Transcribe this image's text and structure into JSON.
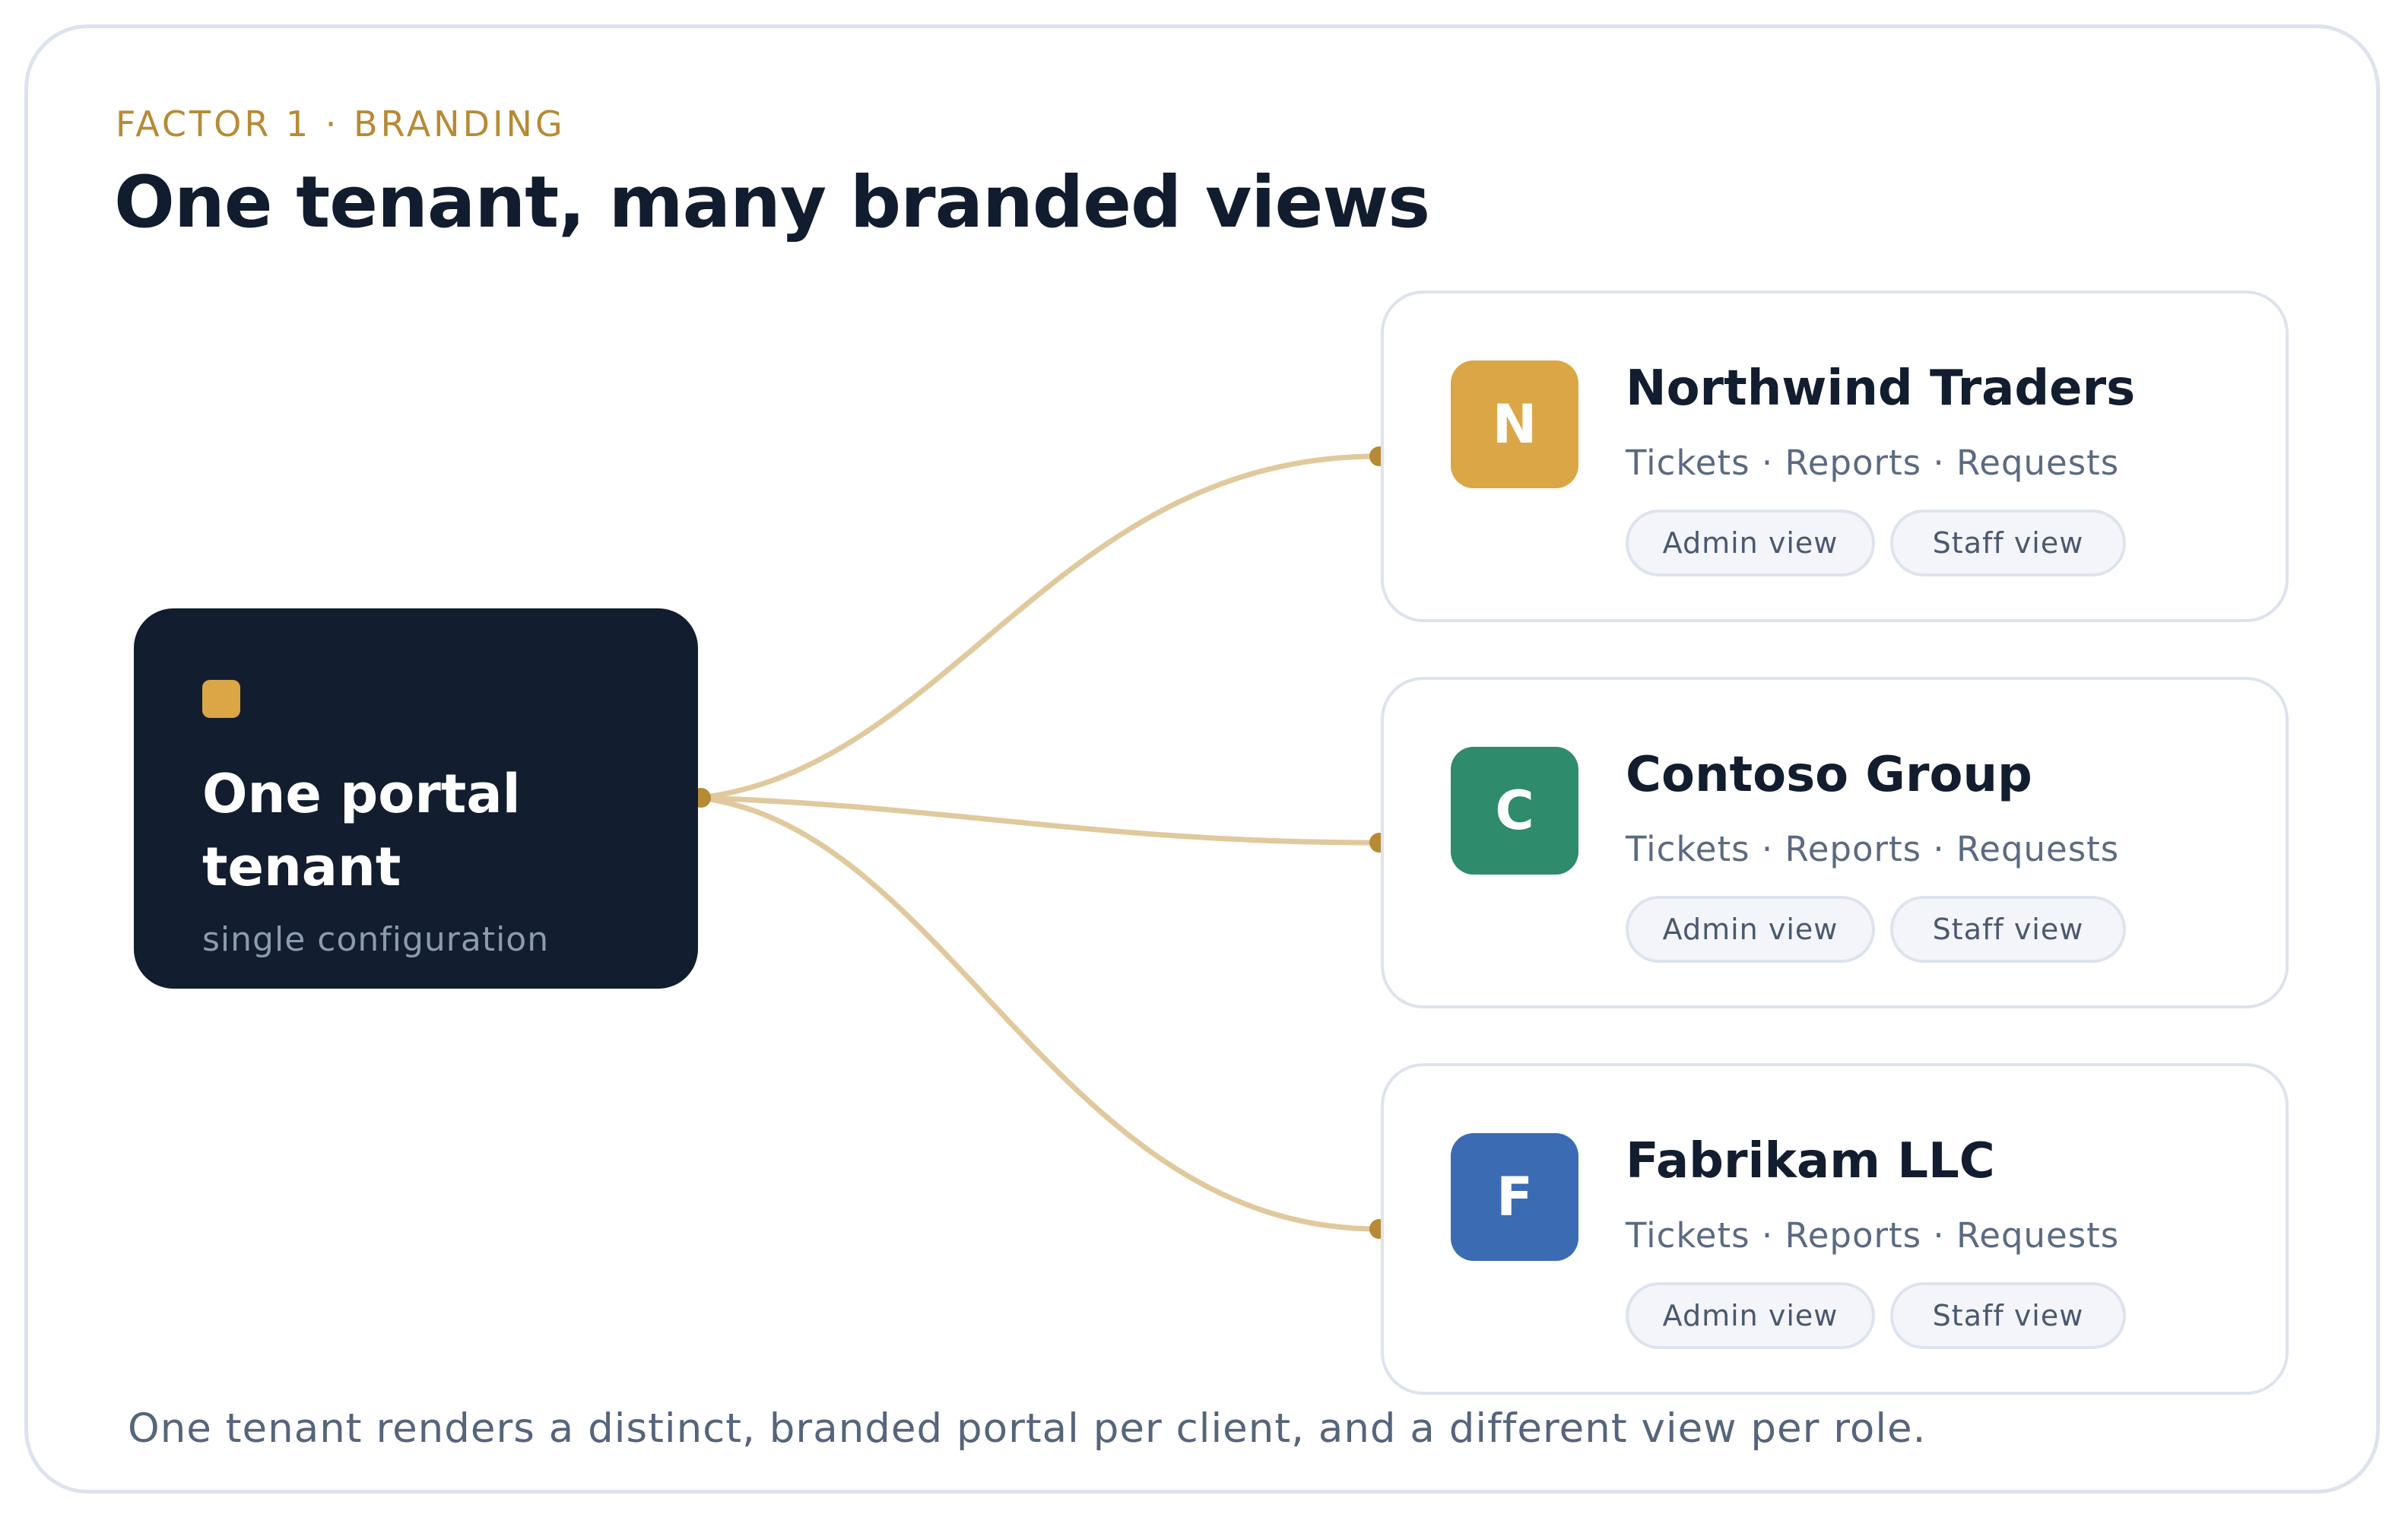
{
  "eyebrow": "FACTOR 1 · BRANDING",
  "title": "One tenant, many branded views",
  "hub": {
    "title": "One portal tenant",
    "subtitle": "single configuration",
    "accent_color": "#dba646",
    "bg_color": "#121d2f"
  },
  "clients": [
    {
      "initial": "N",
      "name": "Northwind Traders",
      "features": "Tickets · Reports · Requests",
      "roles": [
        "Admin view",
        "Staff view"
      ],
      "color": "#dba646"
    },
    {
      "initial": "C",
      "name": "Contoso Group",
      "features": "Tickets · Reports · Requests",
      "roles": [
        "Admin view",
        "Staff view"
      ],
      "color": "#2e8b6c"
    },
    {
      "initial": "F",
      "name": "Fabrikam LLC",
      "features": "Tickets · Reports · Requests",
      "roles": [
        "Admin view",
        "Staff view"
      ],
      "color": "#3b6cb3"
    }
  ],
  "connector_color": "#e0c99d",
  "connector_dot_color": "#b78a35",
  "caption": "One tenant renders a distinct, branded portal per client, and a different view per role."
}
